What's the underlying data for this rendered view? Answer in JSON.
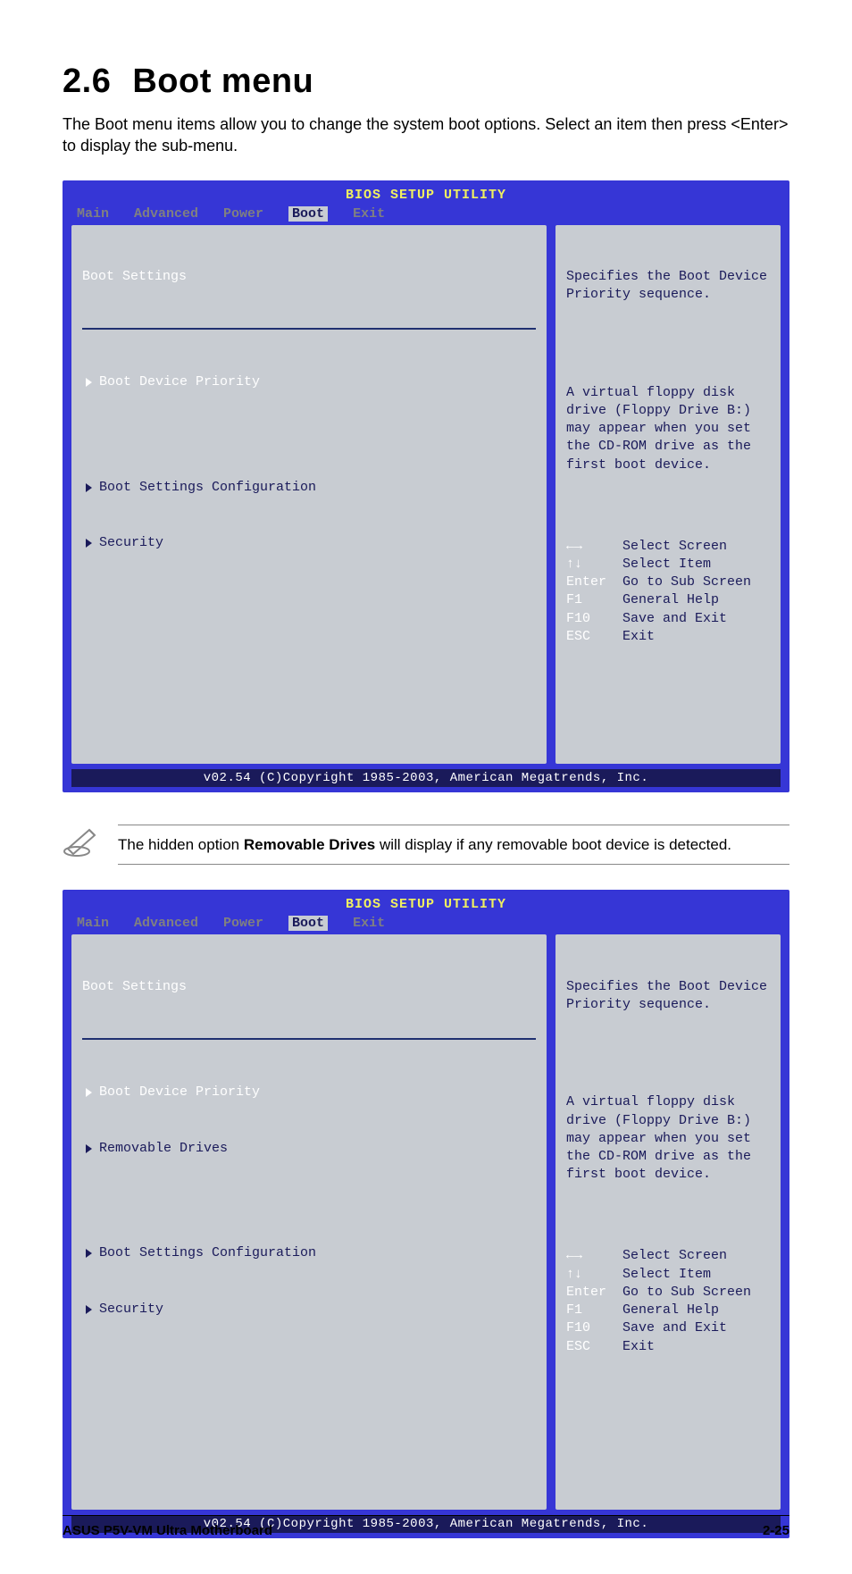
{
  "section": {
    "number": "2.6",
    "title": "Boot menu"
  },
  "intro": "The Boot menu items allow you to change the system boot options. Select an item then press <Enter> to display the sub-menu.",
  "bios": {
    "title": "BIOS SETUP UTILITY",
    "tabs": {
      "main": "Main",
      "advanced": "Advanced",
      "power": "Power",
      "boot": "Boot",
      "exit": "Exit"
    },
    "heading": "Boot Settings",
    "items1": {
      "boot_device_priority": "Boot Device Priority",
      "boot_settings_config": "Boot Settings Configuration",
      "security": "Security"
    },
    "items2": {
      "boot_device_priority": "Boot Device Priority",
      "removable_drives": "Removable Drives",
      "boot_settings_config": "Boot Settings Configuration",
      "security": "Security"
    },
    "help": {
      "p1": "Specifies the Boot Device Priority sequence.",
      "p2": "A virtual floppy disk drive (Floppy Drive B:) may appear when you set the CD-ROM drive as the first boot device."
    },
    "keys": {
      "select_screen": {
        "key": "←→",
        "action": "Select Screen"
      },
      "select_item": {
        "key": "↑↓",
        "action": "Select Item"
      },
      "sub_screen": {
        "key": "Enter",
        "action": "Go to Sub Screen"
      },
      "general_help": {
        "key": "F1",
        "action": "General Help"
      },
      "save_exit": {
        "key": "F10",
        "action": "Save and Exit"
      },
      "exit": {
        "key": "ESC",
        "action": "Exit"
      }
    },
    "copyright": "v02.54 (C)Copyright 1985-2003, American Megatrends, Inc."
  },
  "note": {
    "pre": "The hidden option ",
    "bold": "Removable Drives",
    "post": " will display if any removable boot device is detected."
  },
  "footer": {
    "left": "ASUS P5V-VM Ultra Motherboard",
    "right": "2-25"
  }
}
